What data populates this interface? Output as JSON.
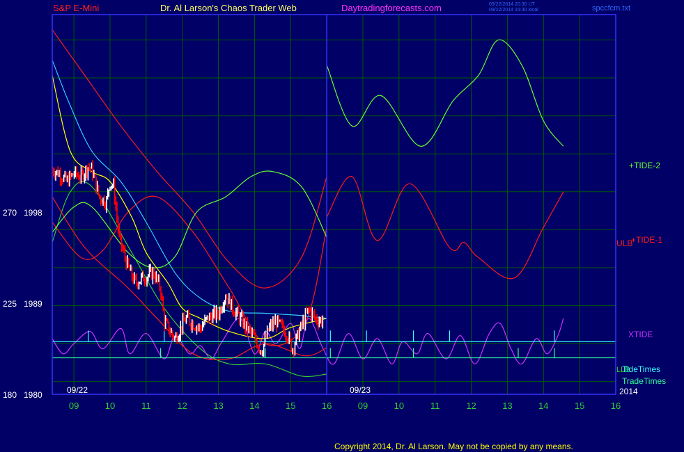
{
  "header": {
    "symbol": "S&P E-Mini",
    "title": "Dr. Al Larson's Chaos Trader Web",
    "site": "Daytradingforecasts.com",
    "timestamp_ut": "09/22/2014 20:30 UT",
    "timestamp_local": "09/22/2014 15:30 local",
    "file": "spccfcm.txt"
  },
  "footer": {
    "copyright": "Copyright 2014, Dr. Al Larson. May not be copied by any means."
  },
  "chart_data": {
    "type": "line",
    "x_ticks": [
      "09",
      "10",
      "11",
      "12",
      "13",
      "14",
      "15",
      "16",
      "09",
      "10",
      "11",
      "12",
      "13",
      "14",
      "15",
      "16"
    ],
    "date_labels": [
      "09/22",
      "09/23"
    ],
    "year_label": "2014",
    "y_ticks": [
      {
        "left": "270",
        "right": "1998"
      },
      {
        "left": "225",
        "right": "1989"
      },
      {
        "left": "180",
        "right": "1980"
      }
    ],
    "ylim": [
      1980,
      2017.5
    ],
    "xlim": [
      8.4,
      24.0
    ],
    "day_boundary": 16.0,
    "hline_labels": {
      "tide_times": "TideTimes",
      "trade_times": "TradeTimes",
      "ulb_low": "LLB"
    },
    "colors": {
      "background": "#000066",
      "grid": "#005a00",
      "frame": "#3333ff",
      "price_up": "#ffffff",
      "price_down": "#ff0000",
      "yellow": "#ffff00",
      "cyan": "#33ccff",
      "red": "#ff1a1a",
      "green": "#33cc33",
      "tide2": "#66ff33",
      "magenta": "#cc33ff",
      "tide_times": "#33ffff",
      "trade_times": "#33ff99"
    },
    "series": [
      {
        "name": "+TIDE-2",
        "color": "#66ff33",
        "points": [
          [
            16.0,
            2012.5
          ],
          [
            16.7,
            2006.5
          ],
          [
            17.5,
            2009.5
          ],
          [
            18.6,
            2004.5
          ],
          [
            19.5,
            2009
          ],
          [
            20.2,
            2011.5
          ],
          [
            20.75,
            2015
          ],
          [
            21.4,
            2012.5
          ],
          [
            22.0,
            2007
          ],
          [
            22.55,
            2004.5
          ]
        ]
      },
      {
        "name": "+TIDE-1",
        "color": "#ff1a1a",
        "points": [
          [
            16.0,
            1997.5
          ],
          [
            16.7,
            2001.5
          ],
          [
            17.4,
            1995.2
          ],
          [
            18.3,
            2000.8
          ],
          [
            19.4,
            1994.5
          ],
          [
            19.8,
            1995
          ],
          [
            20.2,
            1993.5
          ],
          [
            21.2,
            1991.5
          ],
          [
            22.0,
            1996.5
          ],
          [
            22.55,
            2000
          ]
        ]
      },
      {
        "name": "ULB",
        "color": "#ff1a1a",
        "points": [
          [
            8.4,
            2016
          ],
          [
            9.3,
            2011.5
          ],
          [
            10.3,
            2006.5
          ],
          [
            11.3,
            2002
          ],
          [
            12.3,
            1998
          ],
          [
            13.3,
            1993
          ],
          [
            14.3,
            1990.5
          ],
          [
            15.3,
            1993.5
          ],
          [
            16.0,
            2001.5
          ]
        ]
      },
      {
        "name": "LLB",
        "color": "#33cc33",
        "points": [
          [
            8.4,
            1995
          ],
          [
            8.9,
            2000
          ],
          [
            9.5,
            2000.5
          ],
          [
            10.6,
            1994
          ],
          [
            11.5,
            1988.5
          ],
          [
            12.5,
            1984.5
          ],
          [
            13.3,
            1983
          ],
          [
            14.3,
            1983
          ],
          [
            15.3,
            1981.8
          ],
          [
            16.0,
            1982
          ]
        ]
      },
      {
        "name": "XTIDE",
        "color": "#cc33ff",
        "points": [
          [
            8.4,
            1985.5
          ],
          [
            8.7,
            1984
          ],
          [
            9.0,
            1985
          ],
          [
            9.45,
            1986.2
          ],
          [
            9.8,
            1984.5
          ],
          [
            10.3,
            1986.5
          ],
          [
            10.55,
            1984
          ],
          [
            11.0,
            1986
          ],
          [
            11.5,
            1983.5
          ],
          [
            11.8,
            1985.8
          ],
          [
            12.2,
            1984
          ],
          [
            12.5,
            1984.8
          ],
          [
            12.8,
            1983.5
          ],
          [
            13.1,
            1985.2
          ],
          [
            13.6,
            1987.5
          ],
          [
            14.0,
            1984
          ],
          [
            14.3,
            1986.2
          ],
          [
            14.6,
            1985
          ],
          [
            15.0,
            1987
          ],
          [
            15.25,
            1984.5
          ],
          [
            15.5,
            1987.5
          ],
          [
            15.9,
            1984.5
          ],
          [
            16.2,
            1983
          ],
          [
            16.6,
            1986
          ],
          [
            17.0,
            1983.5
          ],
          [
            17.4,
            1985.5
          ],
          [
            17.8,
            1983
          ],
          [
            18.1,
            1985.2
          ],
          [
            18.5,
            1984
          ],
          [
            18.8,
            1986
          ],
          [
            19.3,
            1983.5
          ],
          [
            19.7,
            1985.8
          ],
          [
            20.1,
            1983
          ],
          [
            20.5,
            1986
          ],
          [
            20.8,
            1987
          ],
          [
            21.1,
            1984.5
          ],
          [
            21.4,
            1983
          ],
          [
            21.8,
            1985.5
          ],
          [
            22.1,
            1984
          ],
          [
            22.4,
            1985.8
          ],
          [
            22.55,
            1987.5
          ]
        ]
      },
      {
        "name": "upper-red-band",
        "color": "#ff1a1a",
        "points": [
          [
            8.4,
            1997
          ],
          [
            9.2,
            1993.5
          ],
          [
            9.8,
            1994.2
          ],
          [
            10.5,
            1998
          ],
          [
            11.3,
            1999.5
          ],
          [
            12.3,
            1996
          ],
          [
            13.3,
            1990.5
          ],
          [
            14.3,
            1985
          ],
          [
            15.4,
            1987
          ],
          [
            16.0,
            1996.5
          ]
        ]
      },
      {
        "name": "lower-red-band",
        "color": "#ff1a1a",
        "points": [
          [
            8.4,
            1999.5
          ],
          [
            9.3,
            1994.5
          ],
          [
            10.5,
            1990.5
          ],
          [
            11.3,
            1987.5
          ],
          [
            12.3,
            1984
          ],
          [
            13.3,
            1983.5
          ],
          [
            14.3,
            1985
          ],
          [
            15.4,
            1983.8
          ],
          [
            16.0,
            1984.6
          ]
        ]
      },
      {
        "name": "cyan-average",
        "color": "#33ccff",
        "points": [
          [
            8.4,
            2013
          ],
          [
            8.9,
            2008.5
          ],
          [
            9.5,
            2004
          ],
          [
            10.3,
            2001
          ],
          [
            11.0,
            1997
          ],
          [
            11.8,
            1992
          ],
          [
            12.5,
            1989.5
          ],
          [
            13.3,
            1988.2
          ],
          [
            14.3,
            1988
          ],
          [
            15.2,
            1987.8
          ],
          [
            16.0,
            1987.5
          ]
        ]
      },
      {
        "name": "green-midline",
        "color": "#66ff33",
        "points": [
          [
            8.4,
            1996
          ],
          [
            9.0,
            1998.5
          ],
          [
            9.5,
            1998.5
          ],
          [
            10.5,
            1994
          ],
          [
            11.2,
            1992.5
          ],
          [
            11.8,
            1993.6
          ],
          [
            12.4,
            1998
          ],
          [
            13.2,
            1999.5
          ],
          [
            13.9,
            2001.5
          ],
          [
            14.5,
            2002
          ],
          [
            15.3,
            2000.5
          ],
          [
            16.0,
            1995.5
          ]
        ]
      },
      {
        "name": "yellow-average",
        "color": "#ffff00",
        "points": [
          [
            8.4,
            2011.5
          ],
          [
            8.9,
            2004
          ],
          [
            9.5,
            2002
          ],
          [
            10.0,
            2001
          ],
          [
            10.6,
            1997.5
          ],
          [
            11.0,
            1994
          ],
          [
            11.6,
            1991
          ],
          [
            12.0,
            1988.5
          ],
          [
            12.5,
            1987.5
          ],
          [
            13.3,
            1986.2
          ],
          [
            14.3,
            1985.5
          ],
          [
            15.0,
            1986.6
          ],
          [
            16.0,
            1987.5
          ]
        ]
      }
    ],
    "price_path": [
      [
        8.4,
        2002.2
      ],
      [
        8.6,
        2001.8
      ],
      [
        8.8,
        2001
      ],
      [
        9.0,
        2001.8
      ],
      [
        9.2,
        2001.5
      ],
      [
        9.4,
        2002.5
      ],
      [
        9.5,
        2002.2
      ],
      [
        9.7,
        1999.5
      ],
      [
        9.9,
        1999
      ],
      [
        10.0,
        2001
      ],
      [
        10.1,
        2000.5
      ],
      [
        10.25,
        1995.5
      ],
      [
        10.5,
        1992.5
      ],
      [
        10.7,
        1991
      ],
      [
        10.9,
        1991.5
      ],
      [
        11.2,
        1992
      ],
      [
        11.4,
        1990.5
      ],
      [
        11.5,
        1987.2
      ],
      [
        11.8,
        1985.5
      ],
      [
        12.1,
        1987.5
      ],
      [
        12.5,
        1986.5
      ],
      [
        12.7,
        1987.5
      ],
      [
        13.0,
        1988
      ],
      [
        13.2,
        1989.8
      ],
      [
        13.4,
        1988.5
      ],
      [
        13.6,
        1987.5
      ],
      [
        13.8,
        1986.5
      ],
      [
        14.0,
        1985.5
      ],
      [
        14.2,
        1984.3
      ],
      [
        14.4,
        1986.5
      ],
      [
        14.6,
        1987.2
      ],
      [
        14.9,
        1986
      ],
      [
        15.05,
        1984.5
      ],
      [
        15.3,
        1986.7
      ],
      [
        15.5,
        1988.4
      ],
      [
        15.7,
        1987.4
      ],
      [
        15.9,
        1987.3
      ]
    ],
    "tide_time_spikes": [
      9.4,
      11.5,
      14.3,
      16.1,
      17.1,
      18.4,
      19.4,
      22.3
    ],
    "trade_time_spikes": [
      11.4,
      14.3,
      16.1,
      18.4,
      21.3,
      22.3
    ]
  }
}
